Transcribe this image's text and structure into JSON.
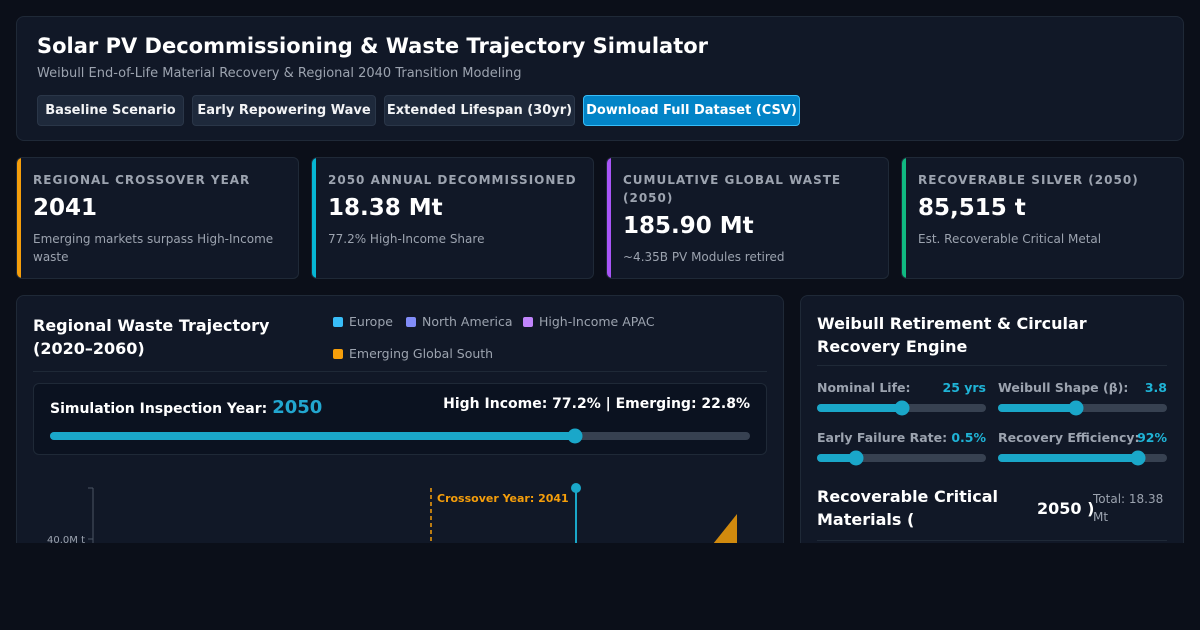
{
  "header": {
    "title": "Solar PV Decommissioning & Waste Trajectory Simulator",
    "subtitle": "Weibull End-of-Life Material Recovery & Regional 2040 Transition Modeling",
    "buttons": [
      "Baseline Scenario",
      "Early Repowering Wave",
      "Extended Lifespan (30yr)",
      "Download Full Dataset (CSV)"
    ]
  },
  "kpis": [
    {
      "label": "REGIONAL CROSSOVER YEAR",
      "value": "2041",
      "note": "Emerging markets surpass High-Income waste",
      "color": "#f59e0b"
    },
    {
      "label": "2050 ANNUAL DECOMMISSIONED",
      "value": "18.38 Mt",
      "note": "77.2% High-Income Share",
      "color": "#06b6d4"
    },
    {
      "label": "CUMULATIVE GLOBAL WASTE (2050)",
      "value": "185.90 Mt",
      "note": "~4.35B PV Modules retired",
      "color": "#a855f7"
    },
    {
      "label": "RECOVERABLE SILVER (2050)",
      "value": "85,515 t",
      "note": "Est. Recoverable Critical Metal",
      "color": "#10b981"
    }
  ],
  "trajectory": {
    "title": "Regional Waste Trajectory (2020–2060)",
    "legend": [
      {
        "name": "Europe",
        "color": "#38bdf8"
      },
      {
        "name": "North America",
        "color": "#818cf8"
      },
      {
        "name": "High-Income APAC",
        "color": "#c084fc"
      },
      {
        "name": "Emerging Global South",
        "color": "#f59e0b"
      }
    ],
    "sim_label": "Simulation Inspection Year:",
    "sim_year": "2050",
    "shares": "High Income: 77.2% | Emerging: 22.8%",
    "year_fraction": 0.75
  },
  "chart_data": {
    "type": "area",
    "y_ticks": [
      "40.0M t"
    ],
    "annotations": [
      "Crossover Year: 2041"
    ],
    "crossover_year": 2041,
    "inspection_year": 2050,
    "x_range": [
      2020,
      2060
    ]
  },
  "engine": {
    "title": "Weibull Retirement & Circular Recovery Engine",
    "controls": [
      {
        "label": "Nominal Life:",
        "value": "25 yrs",
        "fraction": 0.5
      },
      {
        "label": "Weibull Shape (β):",
        "value": "3.8",
        "fraction": 0.46
      },
      {
        "label": "Early Failure Rate:",
        "value": "0.5%",
        "fraction": 0.23
      },
      {
        "label": "Recovery Efficiency:",
        "value": "92%",
        "fraction": 0.83
      }
    ],
    "materials_title": "Recoverable Critical Materials (",
    "materials_year": "2050 )",
    "materials_total": "Total: 18.38 Mt"
  }
}
